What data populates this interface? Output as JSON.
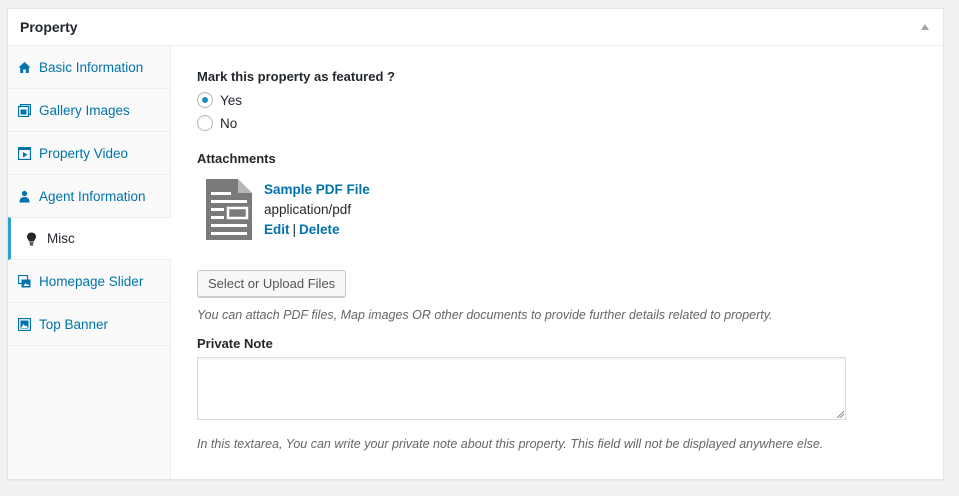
{
  "metabox": {
    "title": "Property",
    "toggle_icon": "arrow-up-icon"
  },
  "tabs": [
    {
      "label": "Basic Information",
      "icon": "home-icon"
    },
    {
      "label": "Gallery Images",
      "icon": "gallery-icon"
    },
    {
      "label": "Property Video",
      "icon": "video-icon"
    },
    {
      "label": "Agent Information",
      "icon": "user-icon"
    },
    {
      "label": "Misc",
      "icon": "lightbulb-icon",
      "active": true
    },
    {
      "label": "Homepage Slider",
      "icon": "slider-icon"
    },
    {
      "label": "Top Banner",
      "icon": "banner-icon"
    }
  ],
  "featured": {
    "label": "Mark this property as featured ?",
    "options": [
      "Yes",
      "No"
    ],
    "selected": "Yes"
  },
  "attachments": {
    "label": "Attachments",
    "file": {
      "name": "Sample PDF File",
      "mime": "application/pdf",
      "edit_label": "Edit",
      "separator": "|",
      "delete_label": "Delete",
      "icon": "document-icon"
    },
    "upload_button": "Select or Upload Files",
    "help": "You can attach PDF files, Map images OR other documents to provide further details related to property."
  },
  "private_note": {
    "label": "Private Note",
    "value": "",
    "help": "In this textarea, You can write your private note about this property. This field will not be displayed anywhere else."
  },
  "colors": {
    "link": "#0073aa",
    "active_tab_border": "#2ea2cc",
    "radio_checked": "#1e8cbe",
    "doc_icon": "#7a7a7a"
  }
}
